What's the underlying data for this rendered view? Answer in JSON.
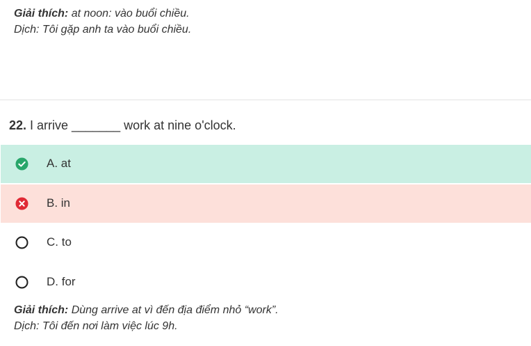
{
  "previous_explanation": {
    "label": "Giải thích:",
    "text": "at noon: vào buổi chiều.",
    "translation": "Dịch: Tôi gặp anh ta vào buổi chiều."
  },
  "question": {
    "number": "22.",
    "text": "I arrive _______ work at nine o'clock."
  },
  "options": [
    {
      "label": "A. at",
      "state": "correct",
      "icon": "check-circle-icon"
    },
    {
      "label": "B. in",
      "state": "wrong",
      "icon": "x-circle-icon"
    },
    {
      "label": "C. to",
      "state": "unselected",
      "icon": "radio-empty-icon"
    },
    {
      "label": "D. for",
      "state": "unselected",
      "icon": "radio-empty-icon"
    }
  ],
  "explanation": {
    "label": "Giải thích:",
    "text": "Dùng arrive at vì đến địa điểm nhỏ “work”.",
    "translation": "Dịch: Tôi đến nơi làm việc lúc 9h."
  },
  "colors": {
    "correct_bg": "#c9efe3",
    "wrong_bg": "#fde0da",
    "correct_icon": "#28a66a",
    "wrong_icon": "#e02a35"
  }
}
